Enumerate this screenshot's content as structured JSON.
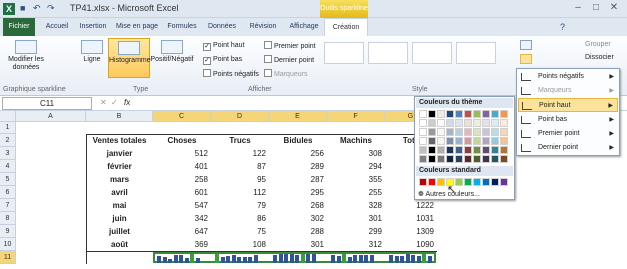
{
  "window": {
    "title": "TP41.xlsx - Microsoft Excel",
    "context_tab": "Outils sparkline"
  },
  "tabs": [
    {
      "label": "Fichier"
    },
    {
      "label": "Accueil"
    },
    {
      "label": "Insertion"
    },
    {
      "label": "Mise en page"
    },
    {
      "label": "Formules"
    },
    {
      "label": "Données"
    },
    {
      "label": "Révision"
    },
    {
      "label": "Affichage"
    },
    {
      "label": "Création"
    }
  ],
  "ribbon": {
    "edit_data": "Modifier les données",
    "line": "Ligne",
    "column": "Histogramme",
    "winloss": "Positif/Négatif",
    "show": {
      "high": "Point haut",
      "low": "Point bas",
      "negative": "Points négatifs",
      "first": "Premier point",
      "last": "Dernier point",
      "markers": "Marqueurs"
    },
    "groups": {
      "sparkline": "Graphique sparkline",
      "type": "Type",
      "show": "Afficher",
      "style": "Style",
      "group": "Grouper",
      "ungroup": "Dissocier"
    }
  },
  "formula_bar": {
    "name_box": "C11",
    "fx": "fx",
    "cancel": "✕",
    "enter": "✓"
  },
  "sheet": {
    "columns": [
      "A",
      "B",
      "C",
      "D",
      "E",
      "F",
      "G"
    ],
    "header_row": [
      "Ventes totales",
      "Choses",
      "Trucs",
      "Bidules",
      "Machins",
      "Tota"
    ],
    "rows": [
      {
        "label": "janvier",
        "v": [
          512,
          122,
          256,
          308
        ]
      },
      {
        "label": "février",
        "v": [
          401,
          87,
          289,
          294
        ]
      },
      {
        "label": "mars",
        "v": [
          258,
          95,
          287,
          355
        ]
      },
      {
        "label": "avril",
        "v": [
          601,
          112,
          295,
          255
        ]
      },
      {
        "label": "mai",
        "v": [
          547,
          79,
          268,
          328
        ],
        "total": 1222
      },
      {
        "label": "juin",
        "v": [
          342,
          86,
          302,
          301
        ],
        "total": 1031
      },
      {
        "label": "juillet",
        "v": [
          647,
          75,
          288,
          299
        ],
        "total": 1309
      },
      {
        "label": "août",
        "v": [
          369,
          108,
          301,
          312
        ],
        "total": 1090
      }
    ]
  },
  "color_panel": {
    "theme_title": "Couleurs du thème",
    "standard_title": "Couleurs standard",
    "more": "Autres couleurs...",
    "theme_top": [
      "#ffffff",
      "#000000",
      "#eeece1",
      "#1f497d",
      "#4f81bd",
      "#c0504d",
      "#9bbb59",
      "#8064a2",
      "#4bacc6",
      "#f79646"
    ],
    "standard": [
      "#c00000",
      "#ff0000",
      "#ffc000",
      "#ffff00",
      "#92d050",
      "#00b050",
      "#00b0f0",
      "#0070c0",
      "#002060",
      "#7030a0"
    ]
  },
  "menu": [
    {
      "label": "Points négatifs"
    },
    {
      "label": "Marqueurs"
    },
    {
      "label": "Point haut"
    },
    {
      "label": "Point bas"
    },
    {
      "label": "Premier point"
    },
    {
      "label": "Dernier point"
    }
  ],
  "colors": {
    "bar": "#2f5597",
    "high": "#3aa03a",
    "accent": "#f5d577"
  }
}
